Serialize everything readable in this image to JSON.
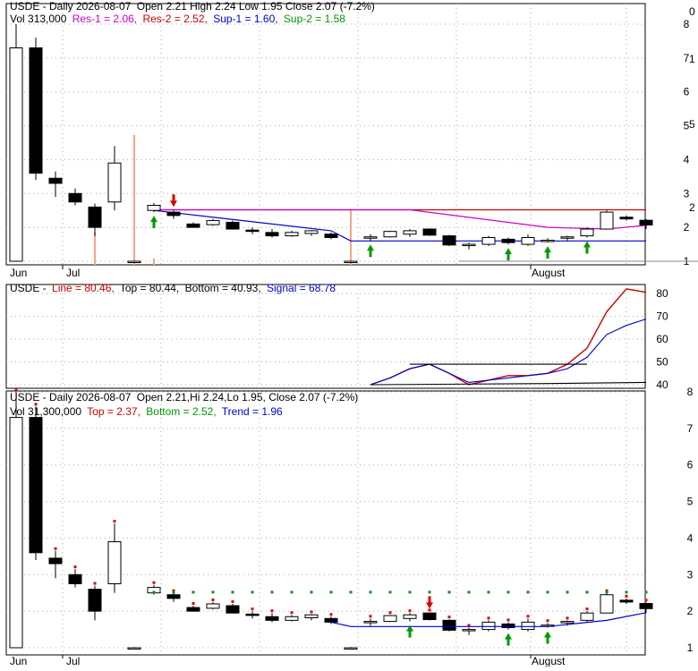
{
  "colors": {
    "up": "#ffffff",
    "down": "#000000",
    "candle_stroke": "#000000",
    "grid": "#aaaaaa",
    "res1": "#cc00cc",
    "res2": "#cc0000",
    "sup1": "#0000cc",
    "sup2": "#009900",
    "vol": "#f4a58a",
    "arrow_up": "#009900",
    "arrow_down": "#dd0000",
    "macd_line": "#cc0000",
    "macd_signal": "#0000cc",
    "macd_bottom": "#000000",
    "trend": "#0000cc",
    "dots": "#009900",
    "red_dot": "#dd0000"
  },
  "chart_data": [
    {
      "type": "candlestick",
      "panel": "price",
      "header": {
        "title": "USDE - Daily 2026-08-07",
        "ohlc_text": "Open 2.21  High 2.24  Low 1.95  Close 2.07 (-7.2%)",
        "vol_text": "Vol 313,000",
        "res1_label": "Res-1 = 2.06,",
        "res2_label": "Res-2 = 2.52,",
        "sup1_label": "Sup-1 = 1.60,",
        "sup2_label": "Sup-2 = 1.58"
      },
      "y_ticks": [
        "8",
        "7",
        "6",
        "5",
        "4",
        "3",
        "2",
        "1"
      ],
      "y_right_extra": [
        "0",
        "1",
        "5",
        "2"
      ],
      "ylim": [
        1,
        8
      ],
      "x_labels": [
        "Jun",
        "Jul",
        "August"
      ],
      "candles": [
        {
          "o": 1.0,
          "h": 8.0,
          "l": 1.0,
          "c": 7.3
        },
        {
          "o": 7.3,
          "h": 7.6,
          "l": 3.4,
          "c": 3.6
        },
        {
          "o": 3.45,
          "h": 3.65,
          "l": 2.9,
          "c": 3.3
        },
        {
          "o": 3.0,
          "h": 3.15,
          "l": 2.65,
          "c": 2.75
        },
        {
          "o": 2.6,
          "h": 2.7,
          "l": 1.75,
          "c": 2.0
        },
        {
          "o": 2.75,
          "h": 4.4,
          "l": 2.5,
          "c": 3.9
        },
        {
          "o": 1.0,
          "h": 1.02,
          "l": 0.98,
          "c": 1.0
        },
        {
          "o": 2.5,
          "h": 2.72,
          "l": 2.45,
          "c": 2.65
        },
        {
          "o": 2.45,
          "h": 2.5,
          "l": 2.25,
          "c": 2.35
        },
        {
          "o": 2.1,
          "h": 2.15,
          "l": 2.0,
          "c": 2.0
        },
        {
          "o": 2.08,
          "h": 2.25,
          "l": 2.05,
          "c": 2.2
        },
        {
          "o": 2.15,
          "h": 2.2,
          "l": 1.95,
          "c": 1.95
        },
        {
          "o": 1.92,
          "h": 2.0,
          "l": 1.8,
          "c": 1.9
        },
        {
          "o": 1.85,
          "h": 1.95,
          "l": 1.7,
          "c": 1.75
        },
        {
          "o": 1.75,
          "h": 1.9,
          "l": 1.72,
          "c": 1.85
        },
        {
          "o": 1.82,
          "h": 1.92,
          "l": 1.75,
          "c": 1.9
        },
        {
          "o": 1.8,
          "h": 1.85,
          "l": 1.65,
          "c": 1.7
        },
        {
          "o": 1.0,
          "h": 1.02,
          "l": 0.98,
          "c": 1.0
        },
        {
          "o": 1.7,
          "h": 1.8,
          "l": 1.6,
          "c": 1.72
        },
        {
          "o": 1.72,
          "h": 1.9,
          "l": 1.7,
          "c": 1.88
        },
        {
          "o": 1.8,
          "h": 1.95,
          "l": 1.72,
          "c": 1.9
        },
        {
          "o": 1.95,
          "h": 1.97,
          "l": 1.75,
          "c": 1.77
        },
        {
          "o": 1.75,
          "h": 1.78,
          "l": 1.45,
          "c": 1.48
        },
        {
          "o": 1.5,
          "h": 1.55,
          "l": 1.35,
          "c": 1.5
        },
        {
          "o": 1.5,
          "h": 1.75,
          "l": 1.45,
          "c": 1.7
        },
        {
          "o": 1.65,
          "h": 1.7,
          "l": 1.5,
          "c": 1.55
        },
        {
          "o": 1.5,
          "h": 1.8,
          "l": 1.45,
          "c": 1.7
        },
        {
          "o": 1.6,
          "h": 1.68,
          "l": 1.55,
          "c": 1.62
        },
        {
          "o": 1.68,
          "h": 1.75,
          "l": 1.6,
          "c": 1.72
        },
        {
          "o": 1.75,
          "h": 2.0,
          "l": 1.7,
          "c": 1.95
        },
        {
          "o": 1.95,
          "h": 2.5,
          "l": 1.95,
          "c": 2.45
        },
        {
          "o": 2.3,
          "h": 2.35,
          "l": 2.2,
          "c": 2.25
        },
        {
          "o": 2.21,
          "h": 2.24,
          "l": 1.95,
          "c": 2.07
        }
      ],
      "volume": [
        0,
        0,
        0,
        0,
        0.25,
        0,
        1.0,
        0.05,
        0,
        0,
        0,
        0,
        0,
        0,
        0,
        0,
        0,
        0.42,
        0,
        0,
        0,
        0,
        0,
        0,
        0,
        0,
        0,
        0,
        0,
        0,
        0,
        0,
        0
      ],
      "res2_line": {
        "from": 7,
        "to": 32,
        "value": 2.52
      },
      "res1_line": {
        "points": [
          [
            7,
            2.52
          ],
          [
            20,
            2.52
          ],
          [
            27,
            2.0
          ],
          [
            30,
            1.95
          ],
          [
            32,
            2.06
          ]
        ]
      },
      "sup1_line": {
        "points": [
          [
            7,
            2.5
          ],
          [
            16,
            1.9
          ],
          [
            17,
            1.6
          ],
          [
            32,
            1.6
          ]
        ]
      },
      "sup2_line": {
        "from": 23,
        "to": 34,
        "value": 1.0
      },
      "arrows_up": [
        7,
        18,
        25,
        27,
        29
      ],
      "arrows_down": [
        8
      ]
    },
    {
      "type": "line",
      "panel": "macd",
      "header": {
        "title": "USDE -",
        "line_label": "Line = 80.46,",
        "top_label": "Top = 80.44,",
        "bottom_label": "Bottom = 40.93,",
        "signal_label": "Signal = 68.78"
      },
      "y_ticks": [
        "80",
        "70",
        "60",
        "50",
        "40"
      ],
      "ylim": [
        38,
        84
      ],
      "series": [
        {
          "role": "line",
          "values": [
            [
              18,
              40
            ],
            [
              19,
              43
            ],
            [
              20,
              47
            ],
            [
              21,
              49
            ],
            [
              22,
              45
            ],
            [
              23,
              40
            ],
            [
              24,
              42
            ],
            [
              25,
              44
            ],
            [
              26,
              44
            ],
            [
              27,
              45
            ],
            [
              28,
              49
            ],
            [
              29,
              56
            ],
            [
              30,
              72
            ],
            [
              31,
              82
            ],
            [
              32,
              80.5
            ]
          ]
        },
        {
          "role": "signal",
          "values": [
            [
              18,
              40
            ],
            [
              19,
              43
            ],
            [
              20,
              47
            ],
            [
              21,
              49
            ],
            [
              22,
              45
            ],
            [
              23,
              41
            ],
            [
              24,
              42
            ],
            [
              25,
              43
            ],
            [
              26,
              44
            ],
            [
              27,
              45
            ],
            [
              28,
              47
            ],
            [
              29,
              52
            ],
            [
              30,
              62
            ],
            [
              31,
              66
            ],
            [
              32,
              68.8
            ]
          ]
        },
        {
          "role": "top",
          "values": [
            [
              20,
              49
            ],
            [
              29,
              49
            ]
          ]
        },
        {
          "role": "bottom",
          "values": [
            [
              18,
              40
            ],
            [
              27,
              40.5
            ],
            [
              32,
              41
            ]
          ]
        }
      ]
    },
    {
      "type": "candlestick",
      "panel": "trend",
      "header": {
        "title": "USDE - Daily 2026-08-07",
        "ohlc_text": "Open 2.21,Hi 2.24,Lo 1.95, Close 2.07 (-7.2%)",
        "vol_text": "Vol 31,300,000",
        "top_label": "Top = 2.37,",
        "bottom_label": "Bottom = 2.52,",
        "trend_label": "Trend = 1.96"
      },
      "y_ticks": [
        "8",
        "7",
        "6",
        "5",
        "4",
        "3",
        "2",
        "1"
      ],
      "ylim": [
        1,
        8
      ],
      "x_labels": [
        "Jun",
        "Jul",
        "August"
      ],
      "dots_level": 2.52,
      "dots_from": 7,
      "dots_to": 32,
      "trend_line": {
        "points": [
          [
            16,
            1.7
          ],
          [
            17,
            1.58
          ],
          [
            27,
            1.58
          ],
          [
            30,
            1.75
          ],
          [
            32,
            1.96
          ]
        ]
      },
      "arrows_up": [
        20,
        25,
        27
      ],
      "arrows_down": [
        21
      ]
    }
  ]
}
